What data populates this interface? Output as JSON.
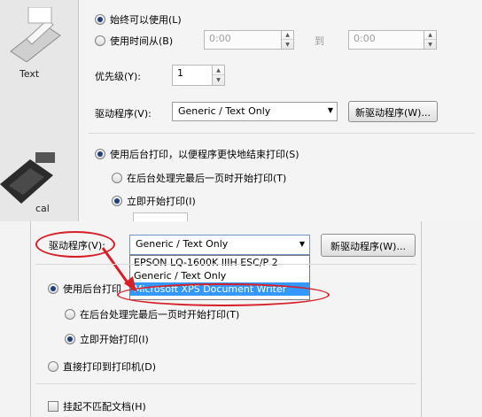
{
  "top": {
    "side_label": "Text",
    "always_available": "始终可以使用(L)",
    "available_from": "使用时间从(B)",
    "time_from": "0:00",
    "to_label": "到",
    "time_to": "0:00",
    "priority_label": "优先级(Y):",
    "priority_value": "1",
    "driver_label": "驱动程序(V):",
    "driver_value": "Generic / Text Only",
    "new_driver_button": "新驱动程序(W)...",
    "spool_label": "使用后台打印，以便程序更快地结束打印(S)",
    "start_after_last": "在后台处理完最后一页时开始打印(T)",
    "start_immediately": "立即开始打印(I)",
    "side_label_2": "cal"
  },
  "bottom": {
    "driver_label": "驱动程序(V):",
    "driver_value": "Generic / Text Only",
    "new_driver_button": "新驱动程序(W)...",
    "driver_options": [
      "EPSON LQ-1600K IIIH ESC/P 2",
      "Generic / Text Only",
      "Microsoft XPS Document Writer"
    ],
    "selected_option_index": 2,
    "spool_label": "使用后台打印",
    "start_after_last": "在后台处理完最后一页时开始打印(T)",
    "start_immediately": "立即开始打印(I)",
    "print_direct": "直接打印到打印机(D)",
    "hold_mismatched": "挂起不匹配文档(H)"
  },
  "colors": {
    "annotation": "#d61f26",
    "selection": "#3399ff"
  },
  "icons": [
    "printer-icon",
    "dropdown-arrow-icon",
    "spin-up-icon",
    "spin-down-icon"
  ]
}
